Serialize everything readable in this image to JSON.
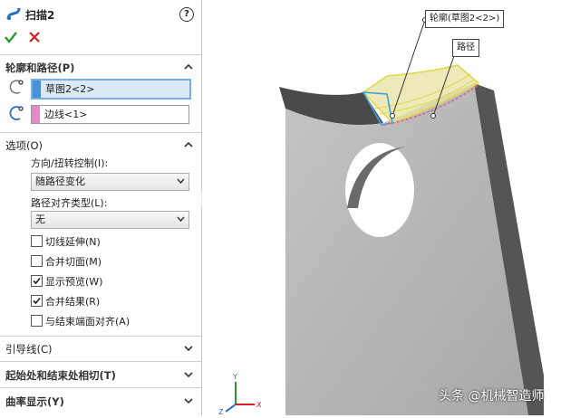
{
  "feature": {
    "title": "扫描2"
  },
  "section_profile": {
    "label": "轮廓和路径(P)",
    "profile_value": "草图2<2>",
    "path_value": "边线<1>"
  },
  "section_options": {
    "label": "选项(O)",
    "orientation_label": "方向/扭转控制(I):",
    "orientation_value": "随路径变化",
    "align_label": "路径对齐类型(L):",
    "align_value": "无",
    "checkboxes": [
      {
        "label": "切线延伸(N)",
        "checked": false
      },
      {
        "label": "合并切面(M)",
        "checked": false
      },
      {
        "label": "显示预览(W)",
        "checked": true
      },
      {
        "label": "合并结果(R)",
        "checked": true
      },
      {
        "label": "与结束端面对齐(A)",
        "checked": false
      }
    ]
  },
  "section_guides": {
    "label": "引导线(C)"
  },
  "section_tangency": {
    "label": "起始处和结束处相切(T)"
  },
  "section_curvature": {
    "label": "曲率显示(Y)"
  },
  "viewport": {
    "callout_profile": "轮廓(草图2<2>)",
    "callout_path": "路径",
    "triad": {
      "x": "X",
      "y": "Y",
      "z": "Z"
    },
    "watermark": "头条 @机械智造师"
  },
  "colors": {
    "profile_swatch": "#4a90d9",
    "path_swatch": "#e888c8",
    "ok": "#2a9a2a",
    "cancel": "#d02020",
    "part": "#b8b8b8",
    "edge_dark": "#4a4a4a",
    "highlight": "#e8e060"
  }
}
